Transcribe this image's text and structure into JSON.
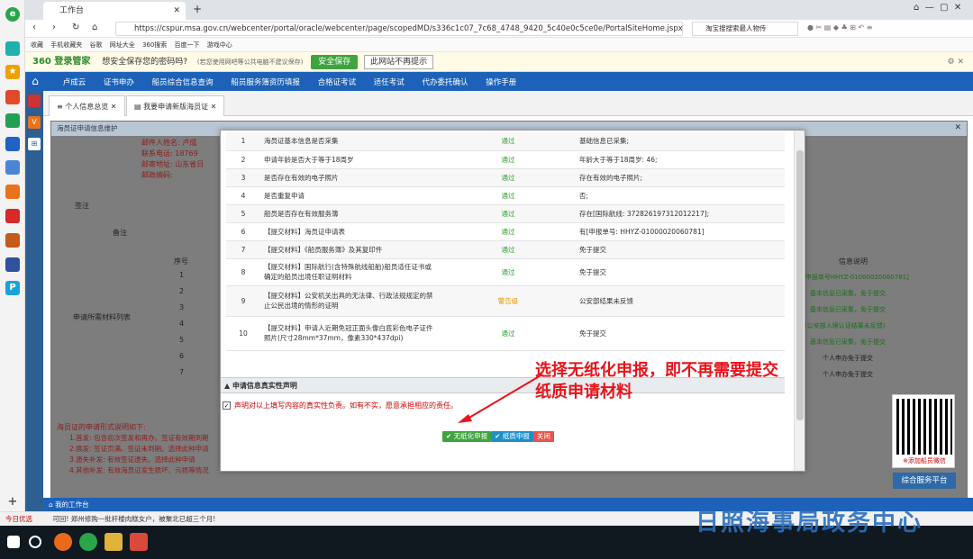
{
  "browser": {
    "tab_title": "工作台",
    "url": "https://cspur.msa.gov.cn/webcenter/portal/oracle/webcenter/page/scopedMD/s336c1c07_7c68_4748_9420_5c40e0c5ce0e/PortalSiteHome.jspx?wc.",
    "search_text": "淘宝搜搜索最人物传",
    "new_tab": "+"
  },
  "bookmarks": [
    "收藏",
    "手机收藏夹",
    "谷歌",
    "网址大全",
    "360搜索",
    "百度一下",
    "游戏中心"
  ],
  "password_bar": {
    "brand": "360 登录管家",
    "question": "想安全保存您的密码吗?",
    "note": "(若您使用网吧等公共电脑不建议保存)",
    "save": "安全保存",
    "dismiss": "此网站不再提示"
  },
  "nav": {
    "items": [
      "卢成云",
      "证书申办",
      "船员综合信息查询",
      "船员服务簿资历填报",
      "合格证考试",
      "适任考试",
      "代办委托确认",
      "操作手册"
    ]
  },
  "app_tabs": [
    "个人信息总览",
    "我要申请新版海员证"
  ],
  "outer_dialog": {
    "title": "海员证申请信息维护"
  },
  "bg": {
    "lines": [
      "邮件人姓名: 卢成",
      "联系电话: 18769",
      "邮寄地址: 山东省日",
      "邮政编码:"
    ],
    "labels": [
      "签注",
      "备注",
      "序号",
      "申请所需材料列表",
      "信息说明"
    ],
    "rows": [
      "1",
      "2",
      "3",
      "4",
      "5",
      "6",
      "7"
    ],
    "info": [
      "[申报单号HHYZ-01000020060781]",
      "基本信息已采集，免于提交",
      "基本信息已采集，免于提交",
      "(公安部入境认证结果未反馈)",
      "基本信息已采集，免于提交",
      "个人申办免于提交",
      "个人申办免于提交"
    ],
    "notes_title": "海员证的申请形式说明如下:",
    "notes": [
      "1.首发: 包含初次签发和再办。签证有效期到期",
      "2.换发: 签证页满、签证未到期。选择此种申请",
      "3.遗失补发: 有效签证遗失。选择此种申请",
      "4.其他补发: 有效海员证发生损坏、污损等情况"
    ]
  },
  "check_table": [
    {
      "no": "1",
      "item": "海员证基本信息是否采集",
      "result": "通过",
      "status": "pass",
      "info": "基础信息已采集;"
    },
    {
      "no": "2",
      "item": "申请年龄是否大于等于18周岁",
      "result": "通过",
      "status": "pass",
      "info": "年龄大于等于18周岁: 46;"
    },
    {
      "no": "3",
      "item": "是否存在有效的电子照片",
      "result": "通过",
      "status": "pass",
      "info": "存在有效的电子照片;"
    },
    {
      "no": "4",
      "item": "是否重复申请",
      "result": "通过",
      "status": "pass",
      "info": "否;"
    },
    {
      "no": "5",
      "item": "船员是否存在有效服务簿",
      "result": "通过",
      "status": "pass",
      "info": "存在[国际航线: 372826197312012217];"
    },
    {
      "no": "6",
      "item": "【提交材料】海员证申请表",
      "result": "通过",
      "status": "pass",
      "info": "有[申报单号: HHYZ-01000020060781]"
    },
    {
      "no": "7",
      "item": "【提交材料】《船员服务簿》及其复印件",
      "result": "通过",
      "status": "pass",
      "info": "免于提交"
    },
    {
      "no": "8",
      "item": "【提交材料】国际航行(含特殊航线船舶)船员适任证书或确定的船员出境任职证明材料",
      "result": "通过",
      "status": "pass",
      "info": "免于提交"
    },
    {
      "no": "9",
      "item": "【提交材料】公安机关出具的无法律、行政法规规定的禁止公民出境的情形的证明",
      "result": "警告级",
      "status": "warn",
      "info": "公安部结果未反馈"
    },
    {
      "no": "10",
      "item": "【提交材料】申请人近期免冠正面头像白底彩色电子证件照片(尺寸28mm*37mm，像素330*437dpi)",
      "result": "通过",
      "status": "pass",
      "info": "免于提交"
    }
  ],
  "declaration": {
    "title": "申请信息真实性声明",
    "text": "声明对以上填写内容的真实性负责。如有不实，愿意承担相应的责任。",
    "check": "✓"
  },
  "buttons": {
    "paperless": "✔ 无纸化申报",
    "paper": "✔ 纸质申报",
    "close": "关闭"
  },
  "annotation": "选择无纸化申报，即不再需要提交纸质申请材料",
  "qr_label": "※添加船员微信",
  "service_button": "综合服务平台",
  "work_label": "我的工作台",
  "status_bar": {
    "left": "今日优选",
    "news": "可回! 郑州修购一批杆楼肉糕女户，被聚北已超三个月!"
  },
  "watermark": "日照海事局政务中心",
  "colors": {
    "nav": "#1d62b8",
    "pass": "#2e9e2e",
    "warn": "#d99a00",
    "annotation": "#e8141b"
  }
}
